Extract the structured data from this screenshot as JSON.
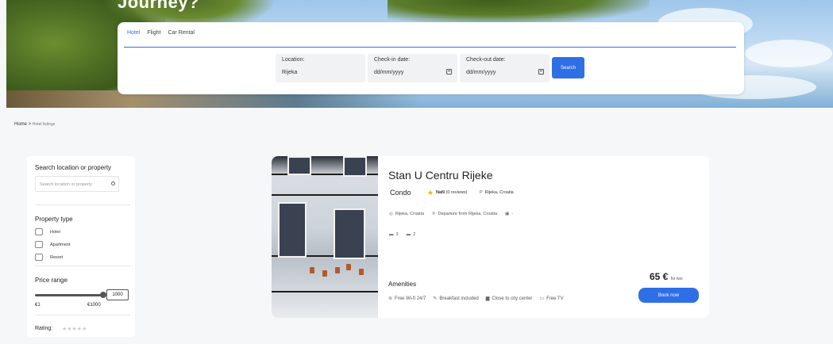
{
  "hero": {
    "title_fragment": "Journey?"
  },
  "search": {
    "tabs": [
      "Hotel",
      "Flight",
      "Car Rental"
    ],
    "location": {
      "label": "Location:",
      "value": "Rijeka"
    },
    "checkin": {
      "label": "Check-in date:",
      "placeholder": "dd/mm/yyyy"
    },
    "checkout": {
      "label": "Check-out date:",
      "placeholder": "dd/mm/yyyy"
    },
    "button": "Search"
  },
  "breadcrumb": {
    "home": "Home",
    "separator": ">",
    "current": "Hotel listings"
  },
  "sidebar": {
    "search_heading": "Search location or property",
    "search_placeholder": "Search location or property",
    "property_heading": "Property type",
    "property_types": [
      "Hotel",
      "Apartment",
      "Resort"
    ],
    "price_heading": "Price range",
    "price_value": "1000",
    "price_min": "€1",
    "price_max": "€1000",
    "price_slider_level": 1.0,
    "rating_label": "Rating:",
    "rating_stars": "★★★★★"
  },
  "listing": {
    "title": "Stan U Centru Rijeke",
    "type": "Condo",
    "rating": "NaN",
    "reviews": "(0 reviews)",
    "location_top": "Rijeka, Croatia",
    "location": "Rijeka, Croatia",
    "departure": "Departure from Rijeka, Croatia",
    "date_suffix": "-",
    "beds": "3",
    "baths": "2",
    "amenities_heading": "Amenities",
    "amenities": [
      "Free Wi-fi 24/7",
      "Breakfast included",
      "Close to city center",
      "Free TV"
    ],
    "price": "65 €",
    "price_suffix": "for two",
    "book_button": "Book now"
  },
  "colors": {
    "accent": "#2f6fe6",
    "star": "#f5b400"
  }
}
